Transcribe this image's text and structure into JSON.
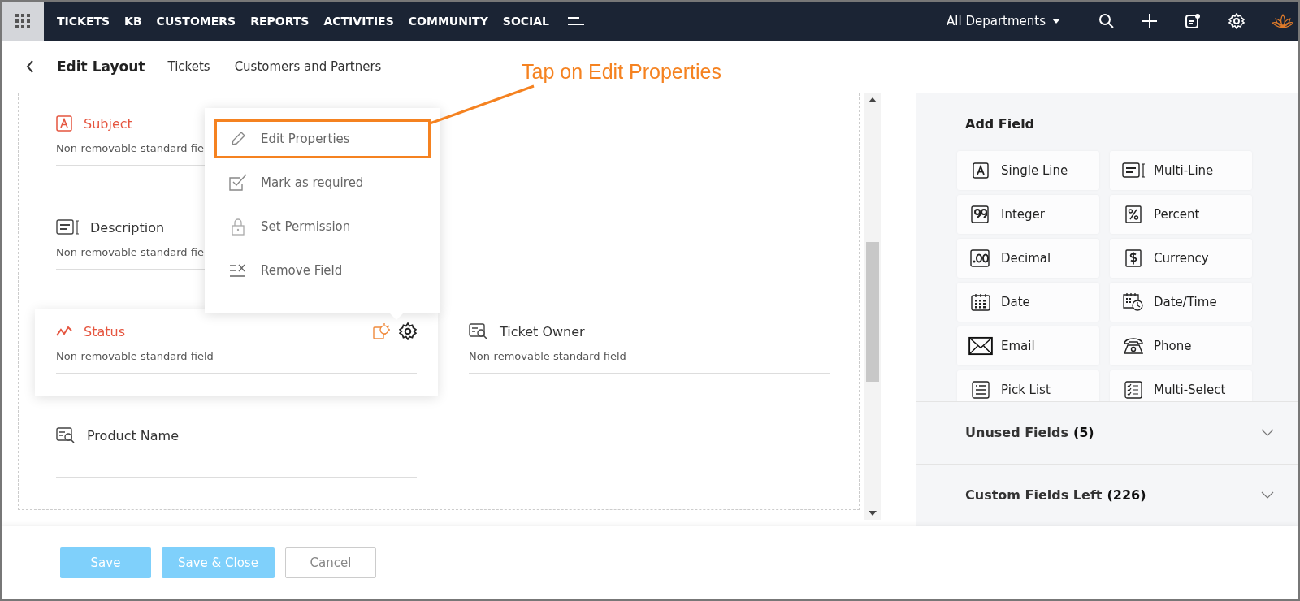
{
  "nav": {
    "items": [
      "TICKETS",
      "KB",
      "CUSTOMERS",
      "REPORTS",
      "ACTIVITIES",
      "COMMUNITY",
      "SOCIAL"
    ],
    "departments": "All Departments"
  },
  "header": {
    "title": "Edit Layout",
    "tabs": [
      "Tickets",
      "Customers and Partners"
    ]
  },
  "fields": [
    {
      "name": "Subject",
      "kind": "text",
      "mandatory": true,
      "active": false,
      "hint": "Non-removable standard fie"
    },
    {
      "kind": "empty"
    },
    {
      "name": "Description",
      "kind": "multiline",
      "mandatory": false,
      "active": false,
      "hint": "Non-removable standard fie"
    },
    {
      "kind": "empty"
    },
    {
      "name": "Status",
      "kind": "status",
      "mandatory": true,
      "active": true,
      "hint": "Non-removable standard field"
    },
    {
      "name": "Ticket Owner",
      "kind": "lookup",
      "mandatory": false,
      "active": false,
      "hint": "Non-removable standard field"
    },
    {
      "name": "Product Name",
      "kind": "lookup",
      "mandatory": false,
      "active": false
    }
  ],
  "menu": {
    "items": [
      {
        "label": "Edit Properties",
        "kind": "edit",
        "outlined": true
      },
      {
        "label": "Mark as required",
        "kind": "required",
        "outlined": false
      },
      {
        "label": "Set Permission",
        "kind": "permission",
        "outlined": false
      },
      {
        "label": "Remove Field",
        "kind": "remove",
        "outlined": false
      }
    ]
  },
  "annotation": {
    "text": "Tap on Edit Properties"
  },
  "add_field": {
    "title": "Add Field",
    "items": [
      {
        "label": "Single Line",
        "kind": "single"
      },
      {
        "label": "Multi-Line",
        "kind": "multi"
      },
      {
        "label": "Integer",
        "kind": "integer"
      },
      {
        "label": "Percent",
        "kind": "percent"
      },
      {
        "label": "Decimal",
        "kind": "decimal"
      },
      {
        "label": "Currency",
        "kind": "currency"
      },
      {
        "label": "Date",
        "kind": "date"
      },
      {
        "label": "Date/Time",
        "kind": "datetime"
      },
      {
        "label": "Email",
        "kind": "email"
      },
      {
        "label": "Phone",
        "kind": "phone"
      },
      {
        "label": "Pick List",
        "kind": "picklist"
      },
      {
        "label": "Multi-Select",
        "kind": "multiselect"
      }
    ]
  },
  "sections": [
    {
      "label": "Unused Fields",
      "count": "(5)",
      "expanded": false
    },
    {
      "label": "Custom Fields Left",
      "count": "(226)",
      "expanded": false
    }
  ],
  "buttons": [
    {
      "label": "Save",
      "kind": "primary"
    },
    {
      "label": "Save & Close",
      "kind": "primary"
    },
    {
      "label": "Cancel",
      "kind": "secondary"
    }
  ]
}
